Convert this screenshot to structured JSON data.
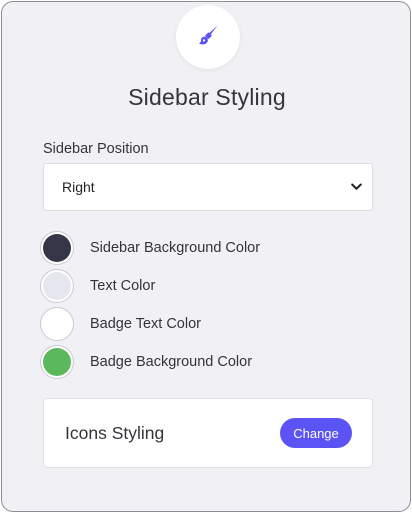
{
  "header": {
    "icon": "paintbrush-icon",
    "icon_color": "#5b53f3",
    "title": "Sidebar Styling"
  },
  "position_field": {
    "label": "Sidebar Position",
    "selected_value": "Right"
  },
  "color_settings": [
    {
      "label": "Sidebar Background Color",
      "color": "#363649"
    },
    {
      "label": "Text Color",
      "color": "#e6e6ee"
    },
    {
      "label": "Badge Text Color",
      "color": "#ffffff"
    },
    {
      "label": "Badge Background Color",
      "color": "#5cb85c"
    }
  ],
  "icons_styling": {
    "title": "Icons Styling",
    "button_label": "Change",
    "button_color": "#5b53f3"
  }
}
